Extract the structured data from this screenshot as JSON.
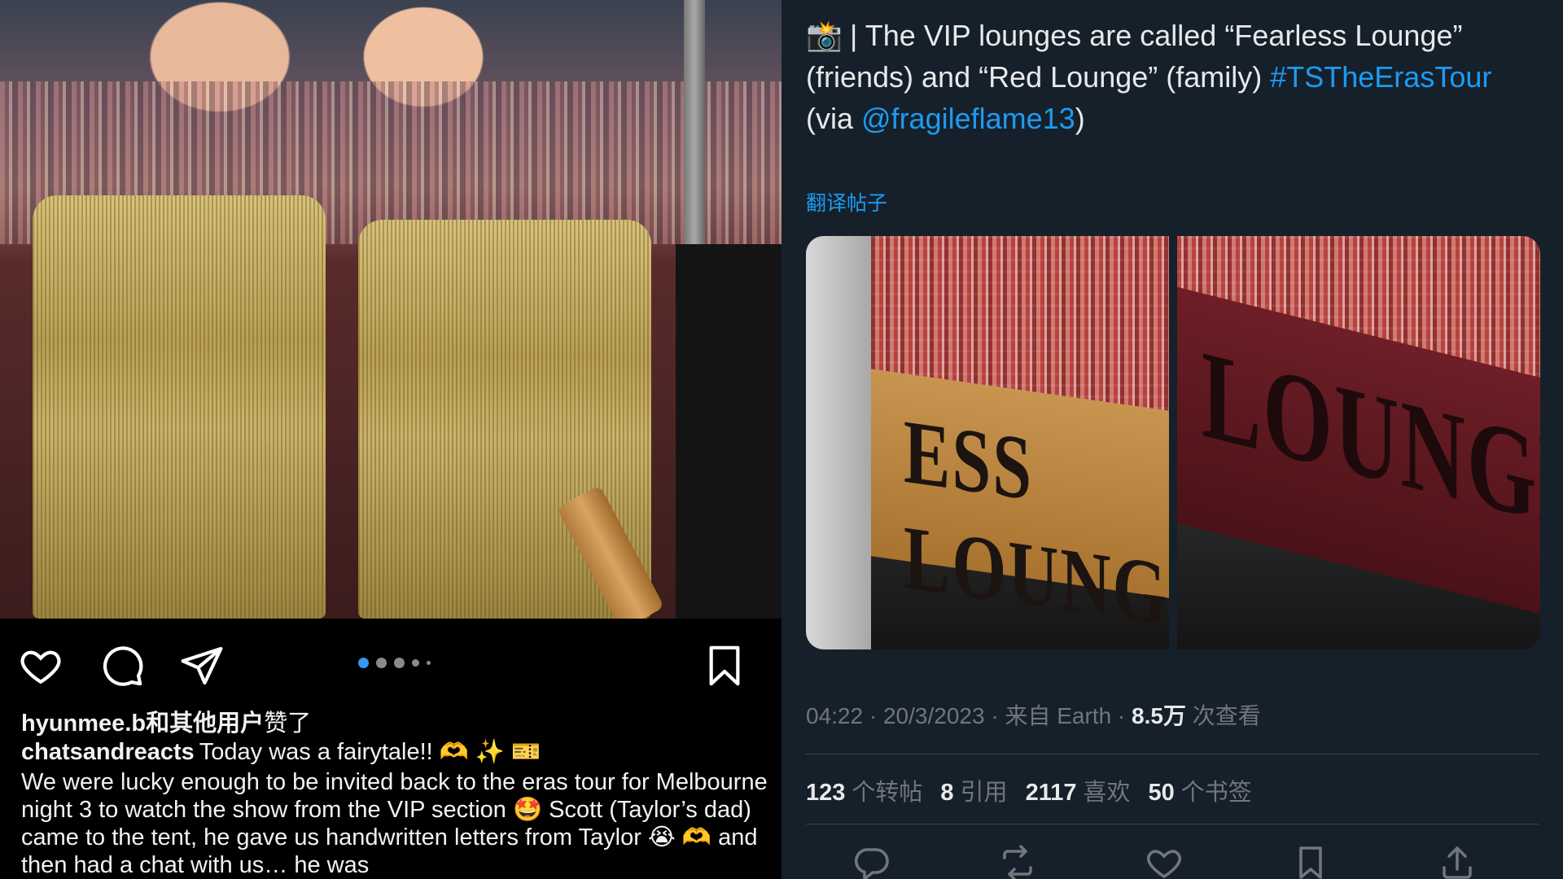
{
  "instagram": {
    "photo_alt": "",
    "carousel": {
      "count": 5,
      "active_index": 0
    },
    "liked_by": {
      "user": "hyunmee.b",
      "suffix": "和其他用户",
      "tail": "赞了"
    },
    "caption": {
      "username": "chatsandreacts",
      "first_line": "Today was a fairytale!! 🫶 ✨ 🎫",
      "body": "We were lucky enough to be invited back to the eras tour for Melbourne night 3 to watch the show from the VIP section 🤩 Scott (Taylor’s dad) came to the tent, he gave us handwritten letters from Taylor 😭 🫶 and then had a chat with us… he was"
    },
    "icons": [
      "heart-icon",
      "comment-icon",
      "share-icon",
      "bookmark-icon"
    ]
  },
  "twitter": {
    "tweet": {
      "emoji": "📸",
      "text_before": " | The VIP lounges are called “Fearless Lounge” (friends) and “Red Lounge” (family) ",
      "hashtag": "#TSTheErasTour",
      "via_prefix": " (via ",
      "mention": "@fragileflame13",
      "via_suffix": ")"
    },
    "translate_label": "翻译帖子",
    "media": [
      {
        "banner_text": "ESS LOUNGE"
      },
      {
        "banner_text": "LOUNGE"
      }
    ],
    "meta": {
      "time": "04:22",
      "date": "20/3/2023",
      "source": "来自 Earth",
      "views_count": "8.5万",
      "views_label": "次查看",
      "separator": " · "
    },
    "stats": [
      {
        "count": "123",
        "label": "个转帖"
      },
      {
        "count": "8",
        "label": "引用"
      },
      {
        "count": "2117",
        "label": "喜欢"
      },
      {
        "count": "50",
        "label": "个书签"
      }
    ],
    "colors": {
      "background": "#15202b",
      "link": "#1d9bf0",
      "muted": "#71767b",
      "text": "#e7e9ea"
    },
    "icons": [
      "reply-icon",
      "retweet-icon",
      "like-icon",
      "bookmark-icon",
      "share-icon"
    ]
  }
}
